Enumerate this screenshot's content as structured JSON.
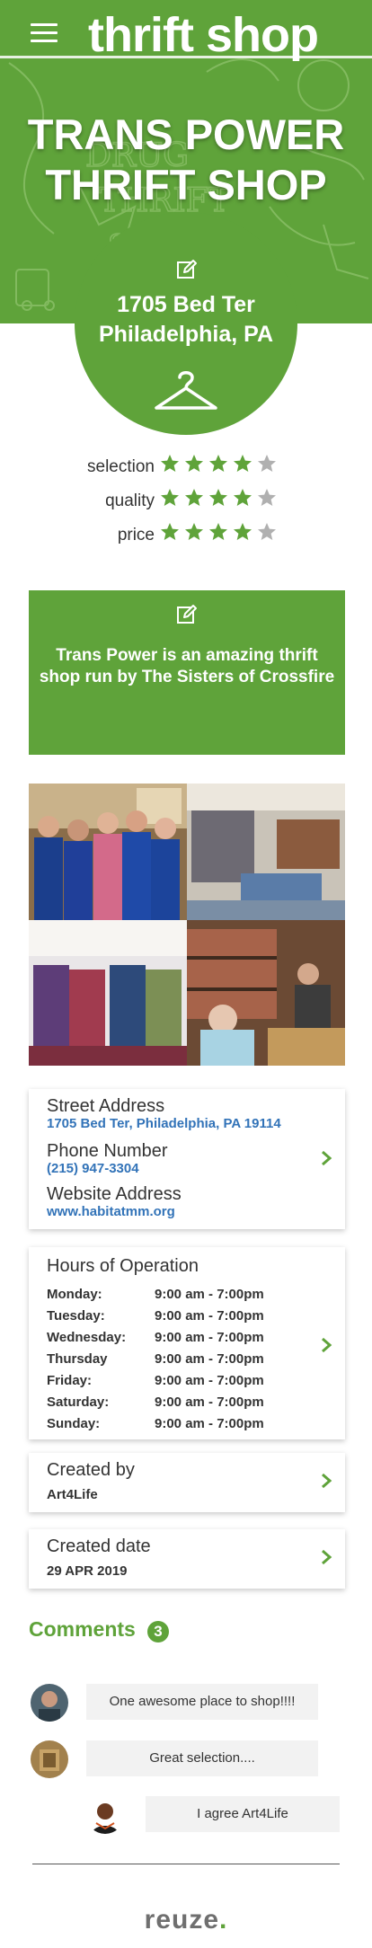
{
  "header": {
    "logo_text": "thrift shop",
    "menu_icon": "hamburger-menu-icon"
  },
  "shop": {
    "name_line1": "TRANS POWER",
    "name_line2": "THRIFT SHOP",
    "address_line1": "1705 Bed Ter",
    "address_line2": "Philadelphia, PA",
    "category_icon": "hanger-icon"
  },
  "ratings": [
    {
      "label": "selection",
      "value": 4,
      "max": 5
    },
    {
      "label": "quality",
      "value": 4,
      "max": 5
    },
    {
      "label": "price",
      "value": 4,
      "max": 5
    }
  ],
  "description": "Trans Power is an amazing thrift shop run by The Sisters of Crossfire",
  "contact": {
    "street_label": "Street Address",
    "street_value": "1705 Bed Ter, Philadelphia, PA 19114",
    "phone_label": "Phone Number",
    "phone_value": "(215) 947-3304",
    "website_label": "Website Address",
    "website_value": "www.habitatmm.org"
  },
  "hours": {
    "title": "Hours of Operation",
    "rows": [
      {
        "day": "Monday:",
        "time": "9:00 am - 7:00pm"
      },
      {
        "day": "Tuesday:",
        "time": "9:00 am - 7:00pm"
      },
      {
        "day": "Wednesday:",
        "time": "9:00 am - 7:00pm"
      },
      {
        "day": "Thursday",
        "time": "9:00 am - 7:00pm"
      },
      {
        "day": "Friday:",
        "time": "9:00 am - 7:00pm"
      },
      {
        "day": "Saturday:",
        "time": "9:00 am - 7:00pm"
      },
      {
        "day": "Sunday:",
        "time": "9:00 am - 7:00pm"
      }
    ]
  },
  "created_by": {
    "label": "Created by",
    "value": "Art4Life"
  },
  "created_date": {
    "label": "Created date",
    "value": "29 APR 2019"
  },
  "comments": {
    "title": "Comments",
    "count": "3",
    "items": [
      {
        "text": "One awesome place to shop!!!!"
      },
      {
        "text": "Great selection...."
      },
      {
        "text": "I agree Art4Life"
      }
    ]
  },
  "footer": {
    "brand": "reuze",
    "brand_dot": "."
  },
  "colors": {
    "accent": "#5fa33a",
    "link": "#3273b8",
    "star_empty": "#b0b0b0"
  }
}
